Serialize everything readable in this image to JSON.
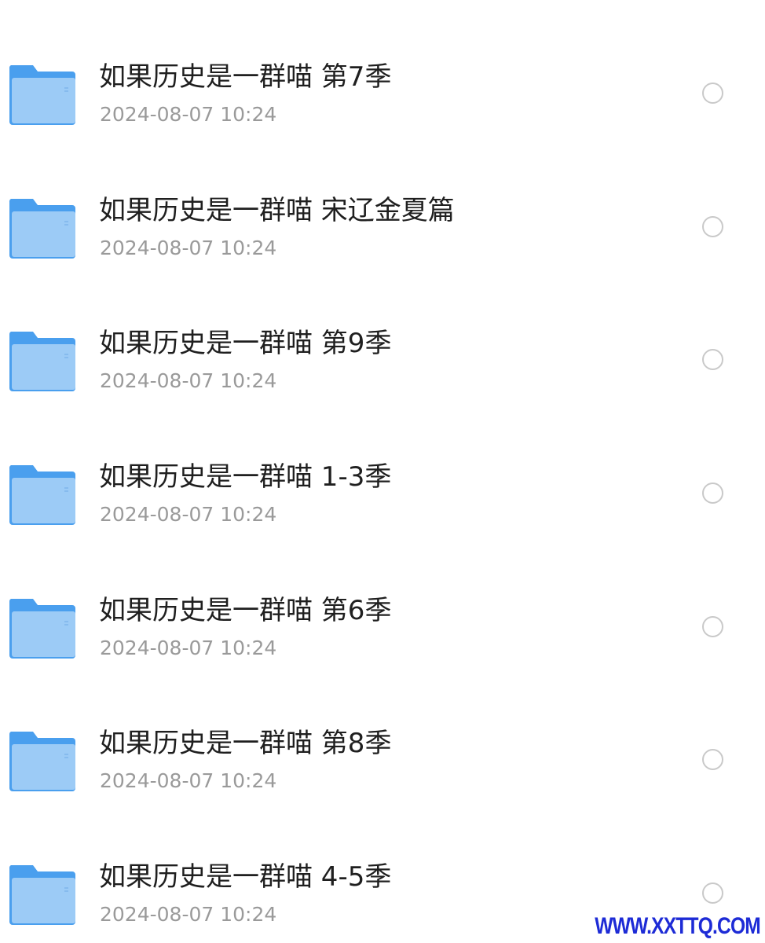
{
  "files": [
    {
      "name": "如果历史是一群喵 第7季",
      "date": "2024-08-07 10:24",
      "icon": "folder-icon",
      "selected": false
    },
    {
      "name": "如果历史是一群喵 宋辽金夏篇",
      "date": "2024-08-07 10:24",
      "icon": "folder-icon",
      "selected": false
    },
    {
      "name": "如果历史是一群喵 第9季",
      "date": "2024-08-07 10:24",
      "icon": "folder-icon",
      "selected": false
    },
    {
      "name": "如果历史是一群喵 1-3季",
      "date": "2024-08-07 10:24",
      "icon": "folder-icon",
      "selected": false
    },
    {
      "name": "如果历史是一群喵 第6季",
      "date": "2024-08-07 10:24",
      "icon": "folder-icon",
      "selected": false
    },
    {
      "name": "如果历史是一群喵 第8季",
      "date": "2024-08-07 10:24",
      "icon": "folder-icon",
      "selected": false
    },
    {
      "name": "如果历史是一群喵 4-5季",
      "date": "2024-08-07 10:24",
      "icon": "folder-icon",
      "selected": false
    }
  ],
  "watermark": "WWW.XXTTQ.COM",
  "colors": {
    "folder_back": "#4a9fee",
    "folder_front": "#9ccbf6",
    "name_text": "#1f1f1f",
    "date_text": "#9a9a9a",
    "circle_border": "#c9c9c9",
    "watermark": "#1d2bd6"
  }
}
